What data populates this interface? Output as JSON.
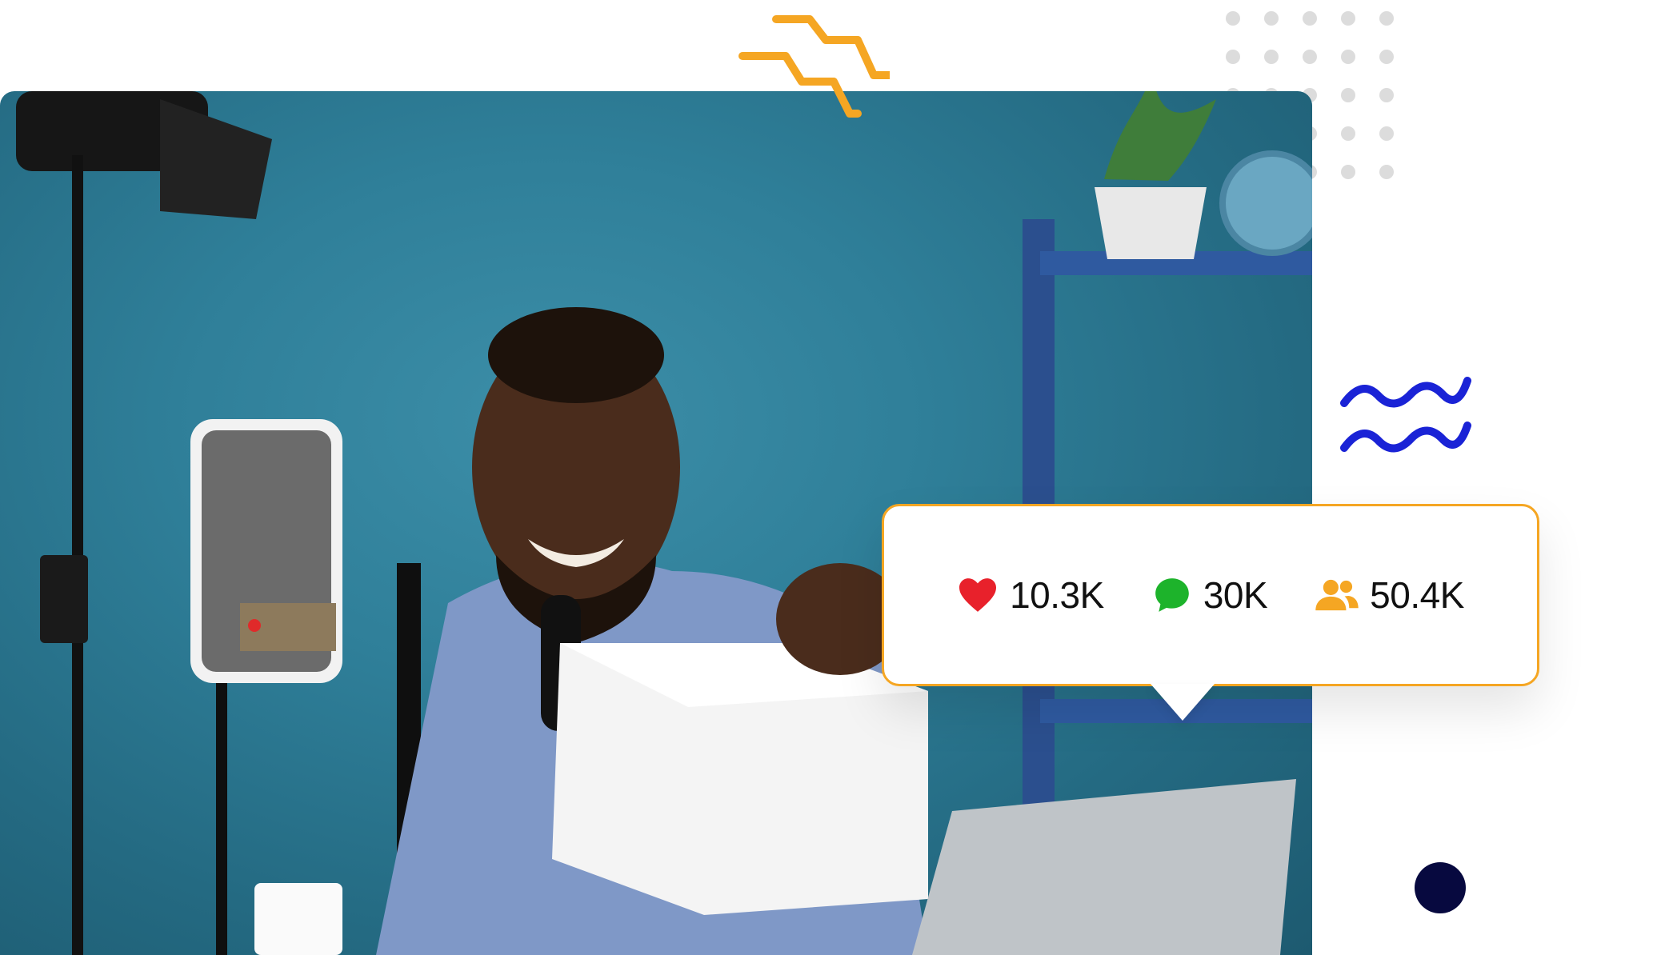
{
  "stats": {
    "likes": {
      "icon": "heart-icon",
      "value": "10.3K",
      "color": "#e8212b"
    },
    "comments": {
      "icon": "chat-bubble-icon",
      "value": "30K",
      "color": "#1db32b"
    },
    "followers": {
      "icon": "users-icon",
      "value": "50.4K",
      "color": "#f5a623"
    }
  },
  "colors": {
    "card_border": "#f5a623",
    "accent_orange": "#f5a623",
    "accent_blue": "#1a23d6",
    "navy": "#07093f",
    "backdrop_teal": "#2f7f99"
  }
}
